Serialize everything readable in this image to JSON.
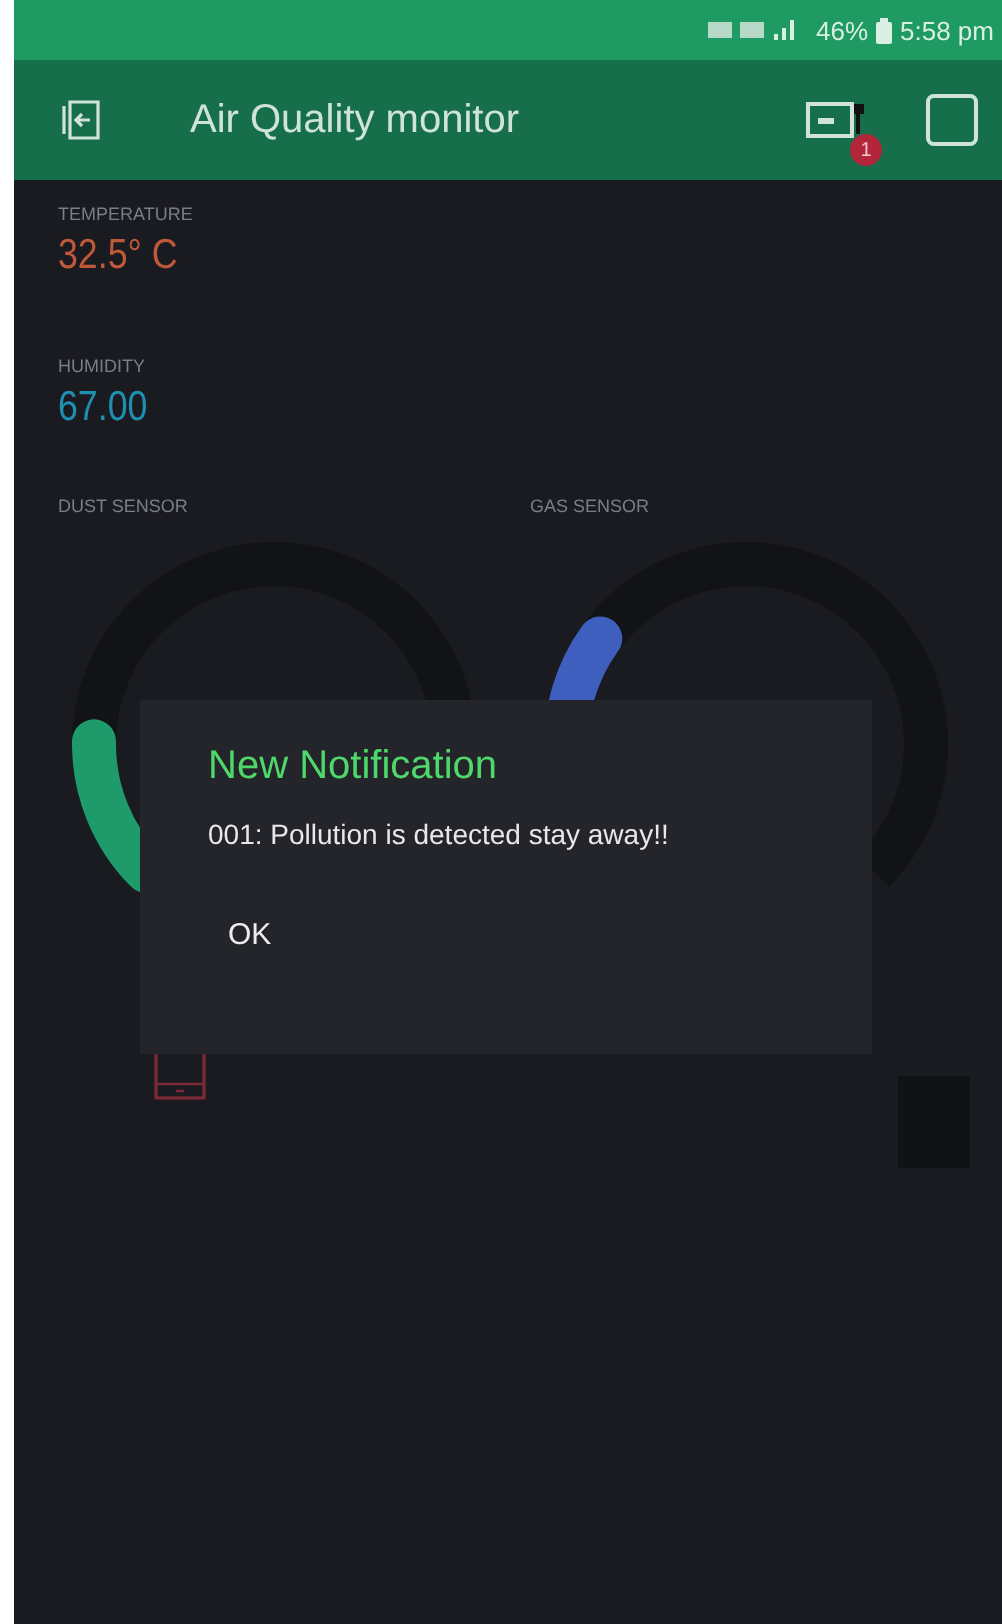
{
  "status_bar": {
    "battery": "46%",
    "time": "5:58 pm"
  },
  "app_bar": {
    "title": "Air Quality monitor",
    "badge": "1"
  },
  "values": [
    {
      "label": "TEMPERATURE",
      "value": "32.5° C",
      "color": "#c0583a"
    },
    {
      "label": "HUMIDITY",
      "value": "67.00",
      "color": "#1f8fb0"
    }
  ],
  "gauges": [
    {
      "label": "DUST SENSOR",
      "color": "#1f9a6a"
    },
    {
      "label": "GAS SENSOR",
      "color": "#3f5fbf"
    }
  ],
  "dialog": {
    "title": "New Notification",
    "message": "001: Pollution is detected stay away!!",
    "button": "OK"
  }
}
